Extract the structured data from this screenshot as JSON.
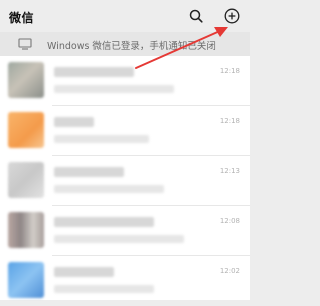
{
  "header": {
    "title": "微信"
  },
  "banner": {
    "text": "Windows 微信已登录，手机通知已关闭"
  },
  "chats": [
    {
      "time": "12:18"
    },
    {
      "time": "12:18"
    },
    {
      "time": "12:13"
    },
    {
      "time": "12:08"
    },
    {
      "time": "12:02"
    }
  ],
  "colors": {
    "background": "#ededed",
    "list_background": "#ffffff",
    "annotation_arrow": "#e53935"
  },
  "icons": [
    "search-icon",
    "add-icon",
    "desktop-monitor-icon"
  ]
}
